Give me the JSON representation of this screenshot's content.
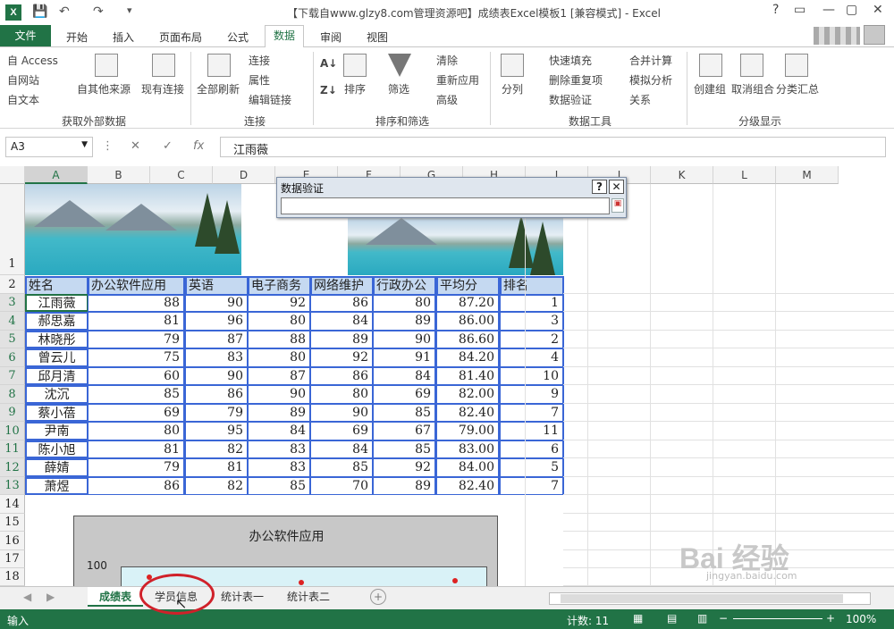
{
  "window": {
    "title": "【下载自www.glzy8.com管理资源吧】成绩表Excel模板1 [兼容模式] - Excel",
    "logo": "X",
    "controls": [
      "?",
      "▭",
      "—",
      "▢",
      "✕"
    ]
  },
  "tabs": [
    "文件",
    "开始",
    "插入",
    "页面布局",
    "公式",
    "数据",
    "审阅",
    "视图"
  ],
  "ribbon": {
    "ext_items": [
      "自 Access",
      "自网站",
      "自文本",
      "自其他来源",
      "现有连接"
    ],
    "ext_group": "获取外部数据",
    "refresh_all": "全部刷新",
    "conn_items": [
      "连接",
      "属性",
      "编辑链接"
    ],
    "conn_group": "连接",
    "sort_items": [
      "排序",
      "筛选"
    ],
    "filter_items": [
      "清除",
      "重新应用",
      "高级"
    ],
    "sort_group": "排序和筛选",
    "split": "分列",
    "tool_items": [
      "快速填充",
      "删除重复项",
      "数据验证"
    ],
    "tool_items2": [
      "合并计算",
      "模拟分析",
      "关系"
    ],
    "tools_group": "数据工具",
    "outline_items": [
      "创建组",
      "取消组合",
      "分类汇总"
    ],
    "outline_group": "分级显示"
  },
  "formula_bar": {
    "namebox": "A3",
    "fx": "fx",
    "value": "江雨薇"
  },
  "columns": [
    "A",
    "B",
    "C",
    "D",
    "E",
    "F",
    "G",
    "H",
    "I",
    "J",
    "K",
    "L",
    "M"
  ],
  "rows": [
    "1",
    "2",
    "3",
    "4",
    "5",
    "6",
    "7",
    "8",
    "9",
    "10",
    "11",
    "12",
    "13",
    "14",
    "15",
    "16",
    "17",
    "18"
  ],
  "table": {
    "headers": [
      "姓名",
      "办公软件应用",
      "英语",
      "电子商务",
      "网络维护",
      "行政办公",
      "平均分",
      "排名"
    ],
    "rows": [
      [
        "江雨薇",
        "88",
        "90",
        "92",
        "86",
        "80",
        "87.20",
        "1"
      ],
      [
        "郝思嘉",
        "81",
        "96",
        "80",
        "84",
        "89",
        "86.00",
        "3"
      ],
      [
        "林晓彤",
        "79",
        "87",
        "88",
        "89",
        "90",
        "86.60",
        "2"
      ],
      [
        "曾云儿",
        "75",
        "83",
        "80",
        "92",
        "91",
        "84.20",
        "4"
      ],
      [
        "邱月清",
        "60",
        "90",
        "87",
        "86",
        "84",
        "81.40",
        "10"
      ],
      [
        "沈沉",
        "85",
        "86",
        "90",
        "80",
        "69",
        "82.00",
        "9"
      ],
      [
        "蔡小蓓",
        "69",
        "79",
        "89",
        "90",
        "85",
        "82.40",
        "7"
      ],
      [
        "尹南",
        "80",
        "95",
        "84",
        "69",
        "67",
        "79.00",
        "11"
      ],
      [
        "陈小旭",
        "81",
        "82",
        "83",
        "84",
        "85",
        "83.00",
        "6"
      ],
      [
        "薛婧",
        "79",
        "81",
        "83",
        "85",
        "92",
        "84.00",
        "5"
      ],
      [
        "萧煜",
        "86",
        "82",
        "85",
        "70",
        "89",
        "82.40",
        "7"
      ]
    ]
  },
  "dialog": {
    "title": "数据验证",
    "help": "?",
    "close": "✕",
    "input": ""
  },
  "chart": {
    "title": "办公软件应用",
    "y_top": "100"
  },
  "sheets": [
    "成绩表",
    "学员信息",
    "统计表一",
    "统计表二"
  ],
  "status": {
    "mode": "输入",
    "count": "计数: 11",
    "zoom": "100%"
  },
  "watermark": {
    "brand": "Bai 经验",
    "url": "jingyan.baidu.com"
  }
}
